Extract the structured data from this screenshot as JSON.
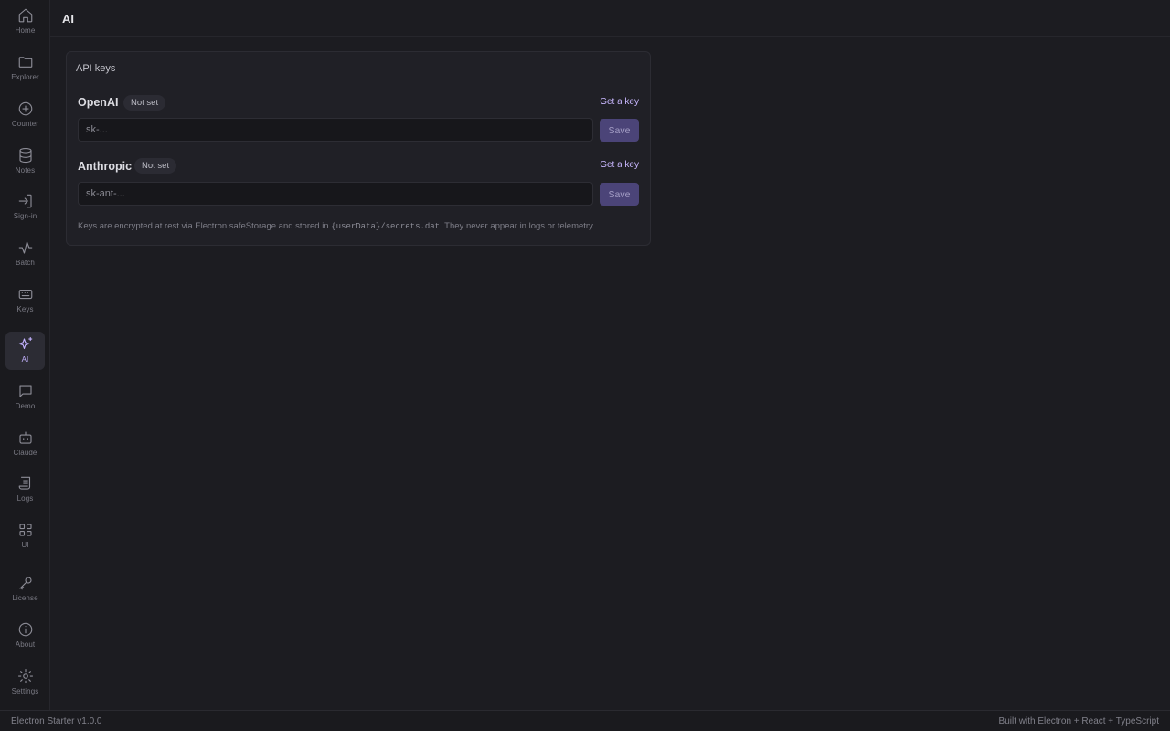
{
  "app": {
    "title": "AI"
  },
  "sidebar": {
    "items": [
      {
        "label": "Home",
        "icon": "home-icon"
      },
      {
        "label": "Explorer",
        "icon": "folder-icon"
      },
      {
        "label": "Counter",
        "icon": "plus-circle-icon"
      },
      {
        "label": "Notes",
        "icon": "database-icon"
      },
      {
        "label": "Sign-in",
        "icon": "sign-in-icon"
      },
      {
        "label": "Batch",
        "icon": "activity-icon"
      },
      {
        "label": "Keys",
        "icon": "keyboard-icon"
      },
      {
        "label": "AI",
        "icon": "sparkles-icon",
        "active": true
      },
      {
        "label": "Demo",
        "icon": "chat-icon"
      },
      {
        "label": "Claude",
        "icon": "bot-icon"
      },
      {
        "label": "Logs",
        "icon": "scroll-icon"
      },
      {
        "label": "UI",
        "icon": "grid-icon"
      },
      {
        "label": "License",
        "icon": "key-icon"
      },
      {
        "label": "About",
        "icon": "info-icon"
      },
      {
        "label": "Settings",
        "icon": "gear-icon"
      }
    ]
  },
  "api_keys": {
    "title": "API keys",
    "providers": [
      {
        "name": "OpenAI",
        "status": "Not set",
        "link": "Get a key",
        "placeholder": "sk-...",
        "save_label": "Save"
      },
      {
        "name": "Anthropic",
        "status": "Not set",
        "link": "Get a key",
        "placeholder": "sk-ant-...",
        "save_label": "Save"
      }
    ],
    "note_pre": "Keys are encrypted at rest via Electron safeStorage and stored in ",
    "note_code": "{userData}/secrets.dat",
    "note_post": ". They never appear in logs or telemetry."
  },
  "status": {
    "left": "Electron Starter v1.0.0",
    "right": "Built with Electron + React + TypeScript"
  },
  "colors": {
    "accent": "#c3b2ff",
    "button": "#4b4478",
    "background": "#1c1c21"
  }
}
